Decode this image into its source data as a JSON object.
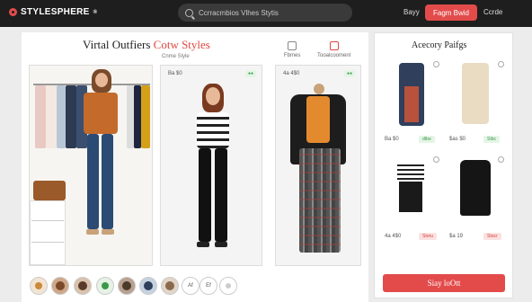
{
  "header": {
    "logo_text": "STYLESPHERE",
    "logo_superscript": "®",
    "search_placeholder": "Ccrracmbios Vlhes Stytis",
    "nav_link": "Bayy",
    "nav_cta": "Fagm Bwid",
    "nav_right": "Ccrde"
  },
  "main": {
    "title_main": "Virtal Outfiers",
    "title_accent": "Cotw Styles",
    "subtitle": "Cnme Slyle",
    "tools": [
      {
        "label": "Fbmes",
        "icon": "hanger-icon"
      },
      {
        "label": "Tooalcoomenl",
        "icon": "tag-icon"
      }
    ],
    "cards": [
      {
        "price": "Ba $0",
        "tag": "●●"
      },
      {
        "price": "4a 4$0",
        "tag": "●●"
      }
    ]
  },
  "accessory": {
    "title": "Acecory Paifgs",
    "items": [
      {
        "price": "Ba $0",
        "badge": "dtbe",
        "badge_type": "green"
      },
      {
        "price": "$as $0",
        "badge": "Stbc",
        "badge_type": "green"
      },
      {
        "price": "4a 4$0",
        "badge": "Storu",
        "badge_type": "red"
      },
      {
        "price": "$a 19",
        "badge": "Stocr",
        "badge_type": "red"
      }
    ],
    "shop_button": "Siay loOtt"
  },
  "thumbnails": [
    "",
    "",
    "",
    "",
    "",
    "",
    "Af",
    "Ef",
    ""
  ],
  "colors": {
    "accent": "#e34b4b",
    "topbar": "#1e1e1e"
  }
}
